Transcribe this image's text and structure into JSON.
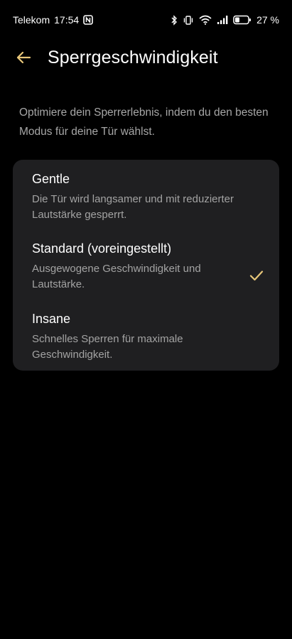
{
  "status_bar": {
    "carrier": "Telekom",
    "time": "17:54",
    "battery_percent": "27 %"
  },
  "header": {
    "title": "Sperrgeschwindigkeit"
  },
  "description": "Optimiere dein Sperrerlebnis, indem du den besten Modus für deine Tür wählst.",
  "options": [
    {
      "title": "Gentle",
      "description": "Die Tür wird langsamer und mit reduzierter Lautstärke gesperrt.",
      "selected": false
    },
    {
      "title": "Standard (voreingestellt)",
      "description": "Ausgewogene Geschwindigkeit und Lautstärke.",
      "selected": true
    },
    {
      "title": "Insane",
      "description": "Schnelles Sperren für maximale Geschwindigkeit.",
      "selected": false
    }
  ],
  "colors": {
    "accent": "#e8c77a",
    "background": "#000000",
    "card": "#1f1f21",
    "secondary_text": "#a3a3a3"
  }
}
